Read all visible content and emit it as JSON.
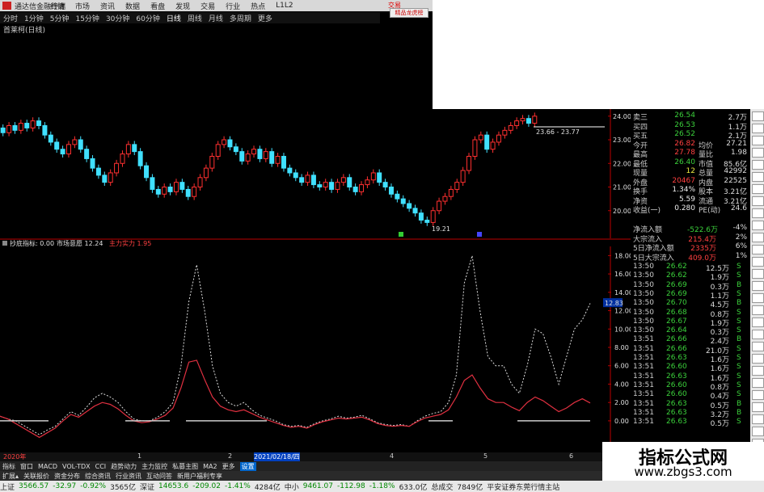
{
  "app": {
    "title": "通达信金融终端",
    "top_red": "交易",
    "top_btn": "精品龙虎榜"
  },
  "menu": [
    "行情",
    "市场",
    "资讯",
    "数据",
    "看盘",
    "发现",
    "交易",
    "行业",
    "热点",
    "L1L2"
  ],
  "periods": [
    "分时",
    "1分钟",
    "5分钟",
    "15分钟",
    "30分钟",
    "60分钟",
    "日线",
    "周线",
    "月线",
    "多周期",
    "更多"
  ],
  "active_period": "日线",
  "stock_label": "首莱柯(日线)",
  "price_axis": [
    "24.00",
    "23.00",
    "22.00",
    "21.00",
    "20.00"
  ],
  "price_annotations": {
    "high_marker": "23.66 - 23.77",
    "low_marker": "19.21"
  },
  "indicator_header": {
    "name": "抄底指标",
    "v0": ": 0.00",
    "l1": "市场意愿",
    "v1": "12.24",
    "l2": "主力实力",
    "v2": "1.95"
  },
  "indicator_axis": [
    "18.00",
    "16.00",
    "14.00",
    "12.00",
    "10.00",
    "8.00",
    "6.00",
    "4.00",
    "2.00",
    "0.00"
  ],
  "indicator_current": "12.83",
  "quote_rows": [
    {
      "l": "卖三",
      "v1": "26.54",
      "c1": "grn",
      "l2": "",
      "v2": "2.7万"
    },
    {
      "l": "买四",
      "v1": "26.53",
      "c1": "grn",
      "l2": "",
      "v2": "1.1万"
    },
    {
      "l": "买五",
      "v1": "26.52",
      "c1": "grn",
      "l2": "",
      "v2": "2.1万"
    },
    {
      "l": "今开",
      "v1": "26.82",
      "c1": "red",
      "l2": "均价",
      "v2": "27.21"
    },
    {
      "l": "最高",
      "v1": "27.78",
      "c1": "red",
      "l2": "量比",
      "v2": "1.98"
    },
    {
      "l": "最低",
      "v1": "26.40",
      "c1": "grn",
      "l2": "市值",
      "v2": "85.6亿"
    },
    {
      "l": "现量",
      "v1": "12",
      "c1": "yel",
      "l2": "总量",
      "v2": "42992"
    },
    {
      "l": "外盘",
      "v1": "20467",
      "c1": "red",
      "l2": "内盘",
      "v2": "22525"
    },
    {
      "l": "换手",
      "v1": "1.34%",
      "c1": "wht",
      "l2": "股本",
      "v2": "3.21亿"
    },
    {
      "l": "净资",
      "v1": "5.59",
      "c1": "wht",
      "l2": "流通",
      "v2": "3.21亿"
    },
    {
      "l": "收益(一)",
      "v1": "0.280",
      "c1": "wht",
      "l2": "PE(动)",
      "v2": "24.6"
    }
  ],
  "flow_rows": [
    {
      "l": "净流入额",
      "v": "-522.6万",
      "p": "-4%"
    },
    {
      "l": "大宗流入",
      "v": "215.4万",
      "p": "2%"
    },
    {
      "l": "5日净流入额",
      "v": "2335万",
      "p": "6%"
    },
    {
      "l": "5日大宗流入",
      "v": "409.0万",
      "p": "1%"
    }
  ],
  "ticks": [
    {
      "t": "13:50",
      "p": "26.62",
      "v": "12.5万",
      "s": "S"
    },
    {
      "t": "13:50",
      "p": "26.62",
      "v": "1.9万",
      "s": "S"
    },
    {
      "t": "13:50",
      "p": "26.69",
      "v": "0.3万",
      "s": "B"
    },
    {
      "t": "13:50",
      "p": "26.69",
      "v": "1.1万",
      "s": "S"
    },
    {
      "t": "13:50",
      "p": "26.70",
      "v": "4.5万",
      "s": "B"
    },
    {
      "t": "13:50",
      "p": "26.68",
      "v": "0.8万",
      "s": "S"
    },
    {
      "t": "13:50",
      "p": "26.67",
      "v": "1.9万",
      "s": "S"
    },
    {
      "t": "13:50",
      "p": "26.64",
      "v": "0.3万",
      "s": "S"
    },
    {
      "t": "13:51",
      "p": "26.66",
      "v": "2.4万",
      "s": "B"
    },
    {
      "t": "13:51",
      "p": "26.66",
      "v": "21.0万",
      "s": "S"
    },
    {
      "t": "13:51",
      "p": "26.63",
      "v": "1.6万",
      "s": "S"
    },
    {
      "t": "13:51",
      "p": "26.60",
      "v": "1.6万",
      "s": "S"
    },
    {
      "t": "13:51",
      "p": "26.63",
      "v": "1.6万",
      "s": "S"
    },
    {
      "t": "13:51",
      "p": "26.60",
      "v": "0.8万",
      "s": "S"
    },
    {
      "t": "13:51",
      "p": "26.60",
      "v": "0.4万",
      "s": "S"
    },
    {
      "t": "13:51",
      "p": "26.63",
      "v": "0.5万",
      "s": "B"
    },
    {
      "t": "13:51",
      "p": "26.63",
      "v": "3.2万",
      "s": "B"
    },
    {
      "t": "13:51",
      "p": "26.63",
      "v": "0.5万",
      "s": "S"
    }
  ],
  "dates": {
    "d0": "2020年",
    "d1": "1",
    "d2": "2",
    "d_sel": "2021/02/18/四",
    "d4": "4",
    "d5": "5",
    "d6": "6"
  },
  "tabs": [
    "指标",
    "窗口",
    "MACD",
    "VOL-TDX",
    "CCI",
    "趋势动力",
    "主力监控",
    "私募主图",
    "MA2",
    "更多",
    "设置"
  ],
  "tabs2": [
    "扩展▴",
    "关联报价",
    "资金分布",
    "综合资讯",
    "行业资讯",
    "互动问答",
    "新用户福利专享"
  ],
  "status": [
    {
      "t": "上证",
      "c": ""
    },
    {
      "t": "3566.57",
      "c": "g"
    },
    {
      "t": "-32.97",
      "c": "g"
    },
    {
      "t": "-0.92%",
      "c": "g"
    },
    {
      "t": "3565亿",
      "c": ""
    },
    {
      "t": "深证",
      "c": ""
    },
    {
      "t": "14653.6",
      "c": "g"
    },
    {
      "t": "-209.02",
      "c": "g"
    },
    {
      "t": "-1.41%",
      "c": "g"
    },
    {
      "t": "4284亿",
      "c": ""
    },
    {
      "t": "中小",
      "c": ""
    },
    {
      "t": "9461.07",
      "c": "g"
    },
    {
      "t": "-112.98",
      "c": "g"
    },
    {
      "t": "-1.18%",
      "c": "g"
    },
    {
      "t": "633.0亿",
      "c": ""
    },
    {
      "t": "总成交",
      "c": ""
    },
    {
      "t": "7849亿",
      "c": ""
    },
    {
      "t": "平安证券东莞行情主站",
      "c": ""
    }
  ],
  "watermark": {
    "title": "指标公式网",
    "url": "www.zbgs3.com"
  },
  "chart_data": {
    "type": "line",
    "candles_close": [
      23.3,
      23.6,
      23.4,
      23.7,
      23.5,
      23.8,
      23.6,
      23.2,
      22.9,
      22.6,
      22.4,
      22.8,
      23.0,
      22.6,
      22.2,
      21.8,
      21.5,
      21.2,
      21.6,
      22.0,
      22.4,
      22.8,
      22.5,
      21.9,
      21.4,
      20.9,
      20.7,
      21.0,
      20.8,
      21.2,
      20.9,
      20.6,
      21.0,
      21.4,
      21.8,
      22.3,
      22.8,
      23.0,
      22.7,
      22.5,
      22.1,
      22.4,
      22.6,
      22.2,
      22.5,
      22.0,
      22.3,
      21.8,
      21.6,
      21.4,
      21.2,
      21.5,
      21.1,
      21.0,
      21.2,
      20.9,
      21.2,
      21.4,
      21.0,
      20.8,
      21.1,
      21.3,
      21.6,
      21.2,
      21.0,
      20.7,
      20.5,
      20.3,
      20.1,
      19.9,
      19.6,
      19.5,
      20.0,
      20.4,
      20.6,
      20.9,
      21.2,
      21.7,
      22.3,
      23.0,
      23.2,
      22.6,
      22.9,
      23.2,
      23.4,
      23.6,
      23.8,
      23.9,
      23.7,
      24.0
    ],
    "willingness": [
      0.5,
      0.2,
      0.0,
      -0.5,
      -1.0,
      -1.5,
      -1.0,
      -0.6,
      0.2,
      1.0,
      0.6,
      1.5,
      2.5,
      3.0,
      2.6,
      2.0,
      1.0,
      0.2,
      0.0,
      0.0,
      0.4,
      1.0,
      2.0,
      6.0,
      13.0,
      17.0,
      12.0,
      6.0,
      3.0,
      2.0,
      1.6,
      2.0,
      1.2,
      0.6,
      0.3,
      0.0,
      -0.4,
      -0.6,
      -0.5,
      -0.7,
      -0.3,
      0.0,
      0.2,
      0.5,
      0.3,
      0.4,
      0.6,
      0.2,
      -0.2,
      -0.4,
      -0.5,
      -0.4,
      -0.6,
      0.0,
      0.5,
      0.8,
      1.0,
      2.0,
      5.0,
      15.0,
      18.0,
      12.0,
      7.0,
      6.0,
      6.0,
      4.0,
      3.0,
      6.0,
      10.0,
      9.5,
      7.0,
      4.0,
      7.0,
      10.0,
      11.0,
      12.8
    ],
    "main_force": [
      0.5,
      0.2,
      -0.3,
      -0.8,
      -1.3,
      -1.8,
      -1.3,
      -0.8,
      0.0,
      0.7,
      0.4,
      1.0,
      1.6,
      2.0,
      1.8,
      1.3,
      0.6,
      0.0,
      -0.2,
      -0.1,
      0.2,
      0.6,
      1.4,
      3.6,
      6.4,
      6.6,
      4.5,
      2.6,
      1.6,
      1.2,
      1.0,
      1.2,
      0.8,
      0.4,
      0.1,
      -0.2,
      -0.5,
      -0.7,
      -0.6,
      -0.8,
      -0.4,
      -0.1,
      0.1,
      0.3,
      0.2,
      0.3,
      0.4,
      0.1,
      -0.3,
      -0.5,
      -0.6,
      -0.5,
      -0.6,
      -0.1,
      0.3,
      0.5,
      0.7,
      1.2,
      2.6,
      4.4,
      5.0,
      3.6,
      2.4,
      2.0,
      2.0,
      1.5,
      1.1,
      2.0,
      2.6,
      2.2,
      1.6,
      1.0,
      1.4,
      2.0,
      2.4,
      1.95
    ],
    "ylim_price": [
      19.0,
      24.3
    ],
    "ylim_indicator": [
      -3,
      19
    ]
  }
}
